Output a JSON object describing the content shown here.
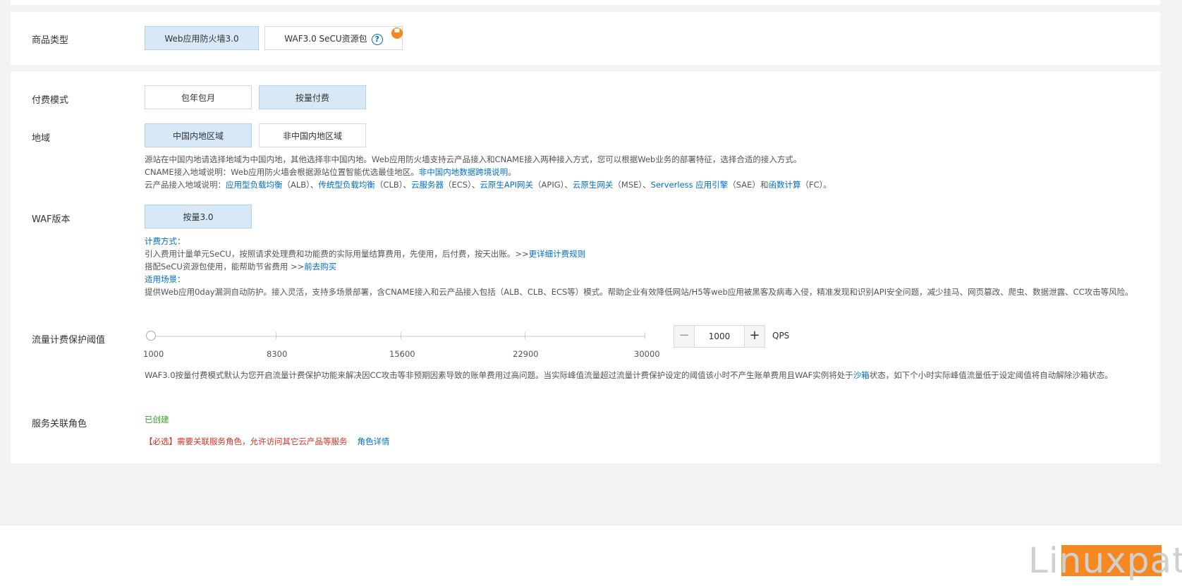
{
  "product_type": {
    "label": "商品类型",
    "options": [
      "Web应用防火墙3.0",
      "WAF3.0 SeCU资源包"
    ],
    "selected": "Web应用防火墙3.0"
  },
  "billing_mode": {
    "label": "付费模式",
    "options": [
      "包年包月",
      "按量付费"
    ],
    "selected": "按量付费"
  },
  "region": {
    "label": "地域",
    "options": [
      "中国内地区域",
      "非中国内地区域"
    ],
    "selected": "中国内地区域",
    "note_line1": "源站在中国内地请选择地域为中国内地，其他选择非中国内地。Web应用防火墙支持云产品接入和CNAME接入两种接入方式，您可以根据Web业务的部署特征，选择合适的接入方式。",
    "note_line2_prefix": "CNAME接入地域说明：Web应用防火墙会根据源站位置智能优选最佳地区。",
    "note_line2_link": "非中国内地数据跨境说明",
    "note_line2_suffix": "。",
    "note_line3": {
      "prefix": "云产品接入地域说明：",
      "link1": "应用型负载均衡",
      "t1": "（ALB）、",
      "link2": "传统型负载均衡",
      "t2": "（CLB）、",
      "link3": "云服务器",
      "t3": "（ECS）、",
      "link4": "云原生API网关",
      "t4": "（APIG）、",
      "link5": "云原生网关",
      "t5": "（MSE）、",
      "link6": "Serverless 应用引擎",
      "t6": "（SAE）和",
      "link7": "函数计算",
      "t7": "（FC）。"
    }
  },
  "waf_version": {
    "label": "WAF版本",
    "option": "按量3.0",
    "billing_head": "计费方式：",
    "billing_line1_text": "引入费用计量单元SeCU，按照请求处理费和功能费的实际用量结算费用，先使用，后付费，按天出账。>>",
    "billing_line1_link": "更详细计费规则",
    "billing_line2_text": "搭配SeCU资源包使用，能帮助节省费用 >>",
    "billing_line2_link": "前去购买",
    "scenario_head": "适用场景：",
    "scenario_text": "提供Web应用0day漏洞自动防护。接入灵活，支持多场景部署，含CNAME接入和云产品接入包括（ALB、CLB、ECS等）模式。帮助企业有效降低网站/H5等web应用被黑客及病毒入侵，精准发现和识别API安全问题，减少挂马、网页篡改、爬虫、数据泄露、CC攻击等风险。"
  },
  "threshold": {
    "label": "流量计费保护阈值",
    "ticks": [
      "1000",
      "8300",
      "15600",
      "22900",
      "30000"
    ],
    "value": "1000",
    "unit": "QPS",
    "minus_symbol": "−",
    "plus_symbol": "+",
    "note_prefix": "WAF3.0按量付费模式默认为您开启流量计费保护功能来解决因CC攻击等非预期因素导致的账单费用过高问题。当实际峰值流量超过流量计费保护设定的阈值该小时不产生账单费用且WAF实例将处于",
    "note_link": "沙箱",
    "note_suffix": "状态，如下个小时实际峰值流量低于设定阈值将自动解除沙箱状态。"
  },
  "service_role": {
    "label": "服务关联角色",
    "status": "已创建",
    "required_text": "【必选】需要关联服务角色，允许访问其它云产品等服务",
    "detail_link": "角色详情"
  },
  "watermark": "Linuxpath",
  "colors": {
    "link": "#0070cc",
    "selected_bg": "#d7e8f7",
    "success": "#2ea121",
    "error": "#d93026",
    "orange": "#f5891f"
  }
}
